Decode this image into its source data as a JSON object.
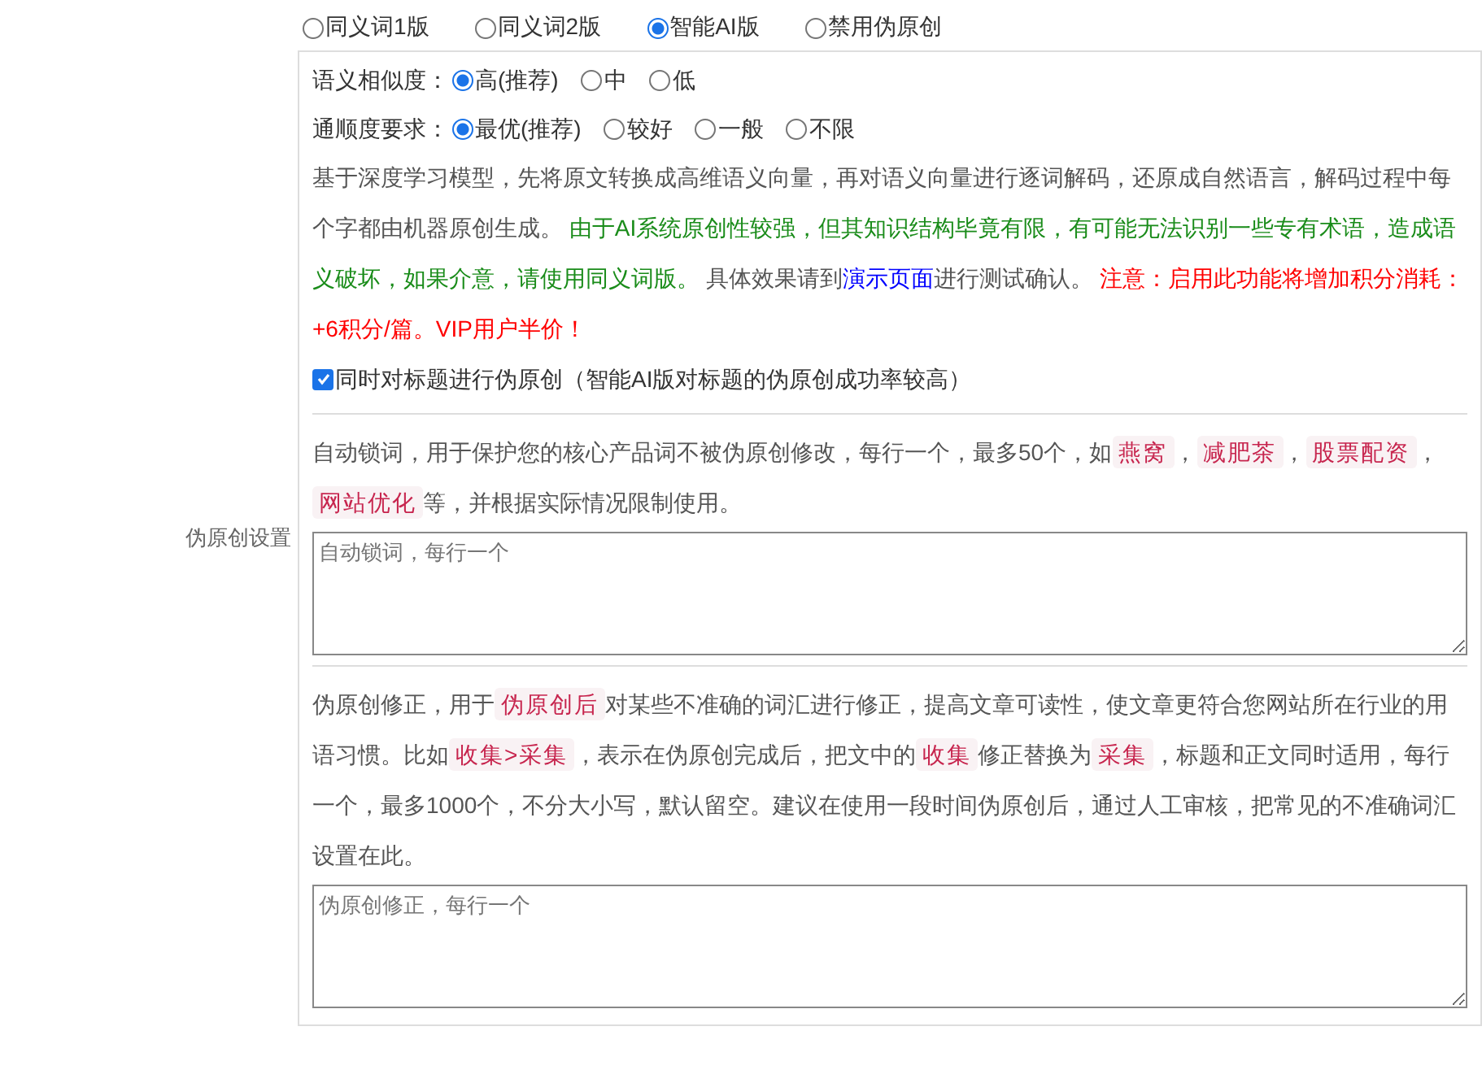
{
  "label": "伪原创设置",
  "modes": [
    {
      "label": "同义词1版",
      "selected": false
    },
    {
      "label": "同义词2版",
      "selected": false
    },
    {
      "label": "智能AI版",
      "selected": true
    },
    {
      "label": "禁用伪原创",
      "selected": false
    }
  ],
  "option_groups": [
    {
      "label": "语义相似度：",
      "options": [
        {
          "label": "高(推荐)",
          "selected": true
        },
        {
          "label": "中",
          "selected": false
        },
        {
          "label": "低",
          "selected": false
        }
      ]
    },
    {
      "label": "通顺度要求：",
      "options": [
        {
          "label": "最优(推荐)",
          "selected": true
        },
        {
          "label": "较好",
          "selected": false
        },
        {
          "label": "一般",
          "selected": false
        },
        {
          "label": "不限",
          "selected": false
        }
      ]
    }
  ],
  "ai_description": [
    {
      "kind": "plain",
      "text": "基于深度学习模型，先将原文转换成高维语义向量，再对语义向量进行逐词解码，还原成自然语言，解码过程中每个字都由机器原创生成。 "
    },
    {
      "kind": "green",
      "text": "由于AI系统原创性较强，但其知识结构毕竟有限，有可能无法识别一些专有术语，造成语义破坏，如果介意，请使用同义词版。"
    },
    {
      "kind": "plain",
      "text": " 具体效果请到"
    },
    {
      "kind": "link",
      "text": "演示页面"
    },
    {
      "kind": "plain",
      "text": "进行测试确认。 "
    },
    {
      "kind": "red",
      "text": "注意：启用此功能将增加积分消耗：+6积分/篇。VIP用户半价！"
    }
  ],
  "title_checkbox": {
    "label": "同时对标题进行伪原创（智能AI版对标题的伪原创成功率较高）",
    "checked": true
  },
  "lock_words": {
    "description": [
      {
        "kind": "plain",
        "text": "自动锁词，用于保护您的核心产品词不被伪原创修改，每行一个，最多50个，如"
      },
      {
        "kind": "tag",
        "text": "燕窝"
      },
      {
        "kind": "plain",
        "text": "，"
      },
      {
        "kind": "tag",
        "text": "减肥茶"
      },
      {
        "kind": "plain",
        "text": "，"
      },
      {
        "kind": "tag",
        "text": "股票配资"
      },
      {
        "kind": "plain",
        "text": "，"
      },
      {
        "kind": "tag",
        "text": "网站优化"
      },
      {
        "kind": "plain",
        "text": "等，并根据实际情况限制使用。"
      }
    ],
    "placeholder": "自动锁词，每行一个"
  },
  "correction": {
    "description": [
      {
        "kind": "plain",
        "text": "伪原创修正，用于"
      },
      {
        "kind": "tag",
        "text": "伪原创后"
      },
      {
        "kind": "plain",
        "text": "对某些不准确的词汇进行修正，提高文章可读性，使文章更符合您网站所在行业的用语习惯。比如"
      },
      {
        "kind": "tag",
        "text": "收集>采集"
      },
      {
        "kind": "plain",
        "text": "，表示在伪原创完成后，把文中的"
      },
      {
        "kind": "tag",
        "text": "收集"
      },
      {
        "kind": "plain",
        "text": "修正替换为"
      },
      {
        "kind": "tag",
        "text": "采集"
      },
      {
        "kind": "plain",
        "text": "，标题和正文同时适用，每行一个，最多1000个，不分大小写，默认留空。建议在使用一段时间伪原创后，通过人工审核，把常见的不准确词汇设置在此。"
      }
    ],
    "placeholder": "伪原创修正，每行一个"
  }
}
